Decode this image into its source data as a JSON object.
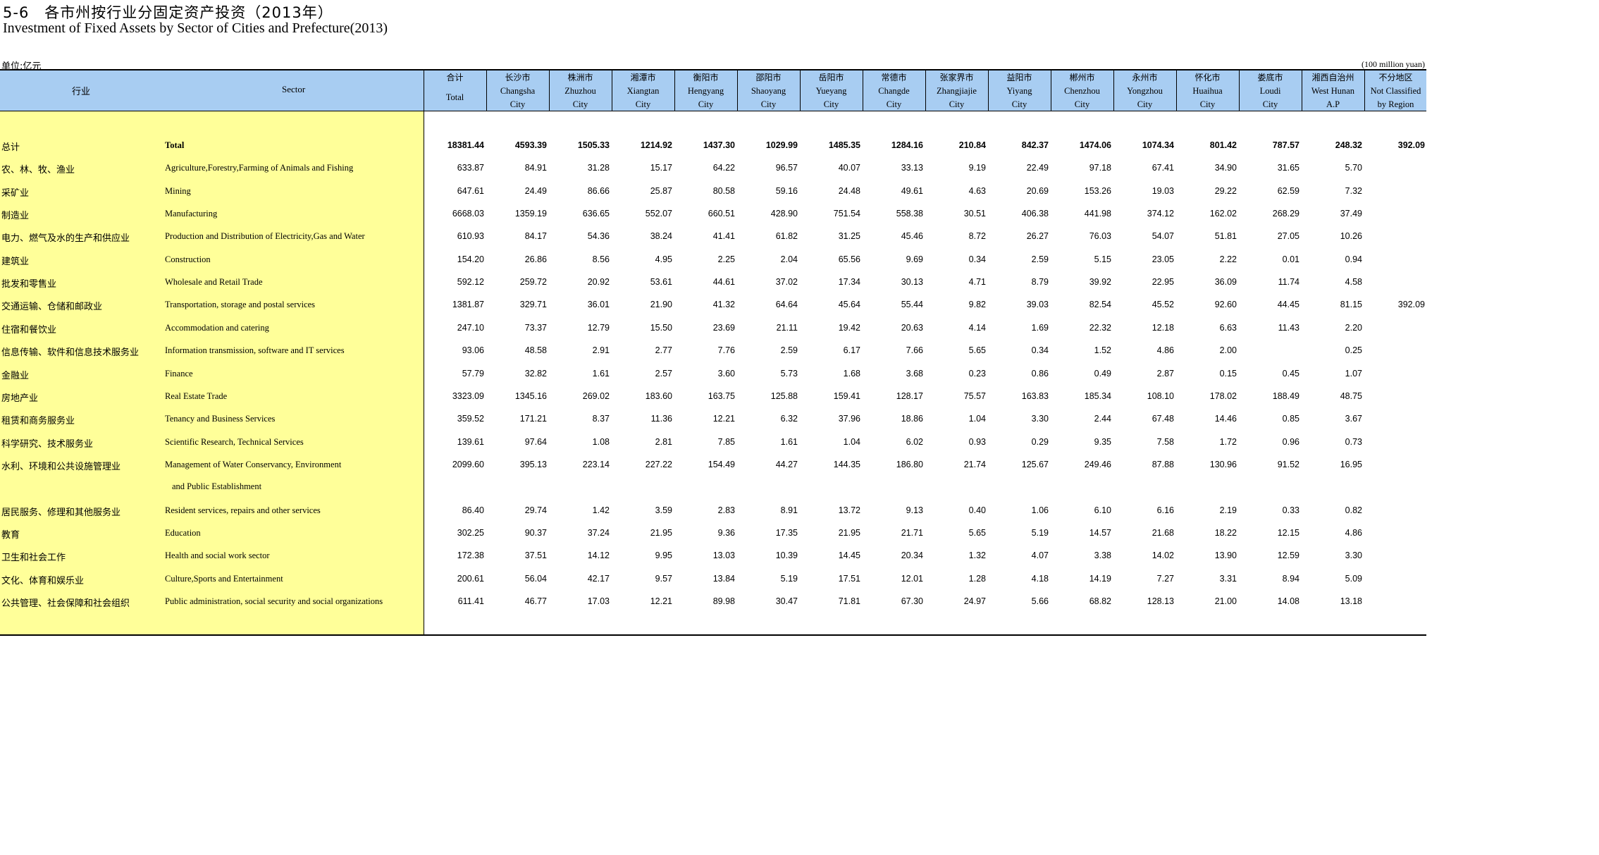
{
  "title_cn": "5-6　各市州按行业分固定资产投资（2013年）",
  "title_en": "Investment  of Fixed Assets by Sector of Cities and Prefecture(2013)",
  "unit_cn": "单位:亿元",
  "unit_en": "(100 million yuan)",
  "header": {
    "sector_cn": "行业",
    "sector_en": "Sector",
    "columns": [
      {
        "l1": "合计",
        "l2": "Total",
        "l3": ""
      },
      {
        "l1": "长沙市",
        "l2": "Changsha",
        "l3": "City"
      },
      {
        "l1": "株洲市",
        "l2": "Zhuzhou",
        "l3": "City"
      },
      {
        "l1": "湘潭市",
        "l2": "Xiangtan",
        "l3": "City"
      },
      {
        "l1": "衡阳市",
        "l2": "Hengyang",
        "l3": "City"
      },
      {
        "l1": "邵阳市",
        "l2": "Shaoyang",
        "l3": "City"
      },
      {
        "l1": "岳阳市",
        "l2": "Yueyang",
        "l3": "City"
      },
      {
        "l1": "常德市",
        "l2": "Changde",
        "l3": "City"
      },
      {
        "l1": "张家界市",
        "l2": "Zhangjiajie",
        "l3": "City"
      },
      {
        "l1": "益阳市",
        "l2": "Yiyang",
        "l3": "City"
      },
      {
        "l1": "郴州市",
        "l2": "Chenzhou",
        "l3": "City"
      },
      {
        "l1": "永州市",
        "l2": "Yongzhou",
        "l3": "City"
      },
      {
        "l1": "怀化市",
        "l2": "Huaihua",
        "l3": "City"
      },
      {
        "l1": "娄底市",
        "l2": "Loudi",
        "l3": "City"
      },
      {
        "l1": "湘西自治州",
        "l2": "West Hunan",
        "l3": "A.P"
      },
      {
        "l1": "不分地区",
        "l2": "Not Classified",
        "l3": "by Region"
      }
    ]
  },
  "rows": [
    {
      "cn": "总计",
      "en": "Total",
      "bold": true,
      "values": [
        "18381.44",
        "4593.39",
        "1505.33",
        "1214.92",
        "1437.30",
        "1029.99",
        "1485.35",
        "1284.16",
        "210.84",
        "842.37",
        "1474.06",
        "1074.34",
        "801.42",
        "787.57",
        "248.32",
        "392.09"
      ]
    },
    {
      "cn": "农、林、牧、渔业",
      "en": "Agriculture,Forestry,Farming of Animals and Fishing",
      "values": [
        "633.87",
        "84.91",
        "31.28",
        "15.17",
        "64.22",
        "96.57",
        "40.07",
        "33.13",
        "9.19",
        "22.49",
        "97.18",
        "67.41",
        "34.90",
        "31.65",
        "5.70",
        ""
      ]
    },
    {
      "cn": "采矿业",
      "en": "Mining",
      "values": [
        "647.61",
        "24.49",
        "86.66",
        "25.87",
        "80.58",
        "59.16",
        "24.48",
        "49.61",
        "4.63",
        "20.69",
        "153.26",
        "19.03",
        "29.22",
        "62.59",
        "7.32",
        ""
      ]
    },
    {
      "cn": "制造业",
      "en": "Manufacturing",
      "values": [
        "6668.03",
        "1359.19",
        "636.65",
        "552.07",
        "660.51",
        "428.90",
        "751.54",
        "558.38",
        "30.51",
        "406.38",
        "441.98",
        "374.12",
        "162.02",
        "268.29",
        "37.49",
        ""
      ]
    },
    {
      "cn": "电力、燃气及水的生产和供应业",
      "en": "Production and Distribution of Electricity,Gas and Water",
      "values": [
        "610.93",
        "84.17",
        "54.36",
        "38.24",
        "41.41",
        "61.82",
        "31.25",
        "45.46",
        "8.72",
        "26.27",
        "76.03",
        "54.07",
        "51.81",
        "27.05",
        "10.26",
        ""
      ]
    },
    {
      "cn": "建筑业",
      "en": "Construction",
      "values": [
        "154.20",
        "26.86",
        "8.56",
        "4.95",
        "2.25",
        "2.04",
        "65.56",
        "9.69",
        "0.34",
        "2.59",
        "5.15",
        "23.05",
        "2.22",
        "0.01",
        "0.94",
        ""
      ]
    },
    {
      "cn": "批发和零售业",
      "en": "Wholesale and Retail Trade",
      "values": [
        "592.12",
        "259.72",
        "20.92",
        "53.61",
        "44.61",
        "37.02",
        "17.34",
        "30.13",
        "4.71",
        "8.79",
        "39.92",
        "22.95",
        "36.09",
        "11.74",
        "4.58",
        ""
      ]
    },
    {
      "cn": "交通运输、仓储和邮政业",
      "en": "Transportation, storage and postal services",
      "values": [
        "1381.87",
        "329.71",
        "36.01",
        "21.90",
        "41.32",
        "64.64",
        "45.64",
        "55.44",
        "9.82",
        "39.03",
        "82.54",
        "45.52",
        "92.60",
        "44.45",
        "81.15",
        "392.09"
      ]
    },
    {
      "cn": "住宿和餐饮业",
      "en": "Accommodation and catering",
      "values": [
        "247.10",
        "73.37",
        "12.79",
        "15.50",
        "23.69",
        "21.11",
        "19.42",
        "20.63",
        "4.14",
        "1.69",
        "22.32",
        "12.18",
        "6.63",
        "11.43",
        "2.20",
        ""
      ]
    },
    {
      "cn": "信息传输、软件和信息技术服务业",
      "en": "Information transmission, software and IT services",
      "values": [
        "93.06",
        "48.58",
        "2.91",
        "2.77",
        "7.76",
        "2.59",
        "6.17",
        "7.66",
        "5.65",
        "0.34",
        "1.52",
        "4.86",
        "2.00",
        "",
        "0.25",
        ""
      ]
    },
    {
      "cn": "金融业",
      "en": "Finance",
      "values": [
        "57.79",
        "32.82",
        "1.61",
        "2.57",
        "3.60",
        "5.73",
        "1.68",
        "3.68",
        "0.23",
        "0.86",
        "0.49",
        "2.87",
        "0.15",
        "0.45",
        "1.07",
        ""
      ]
    },
    {
      "cn": "房地产业",
      "en": "Real Estate Trade",
      "values": [
        "3323.09",
        "1345.16",
        "269.02",
        "183.60",
        "163.75",
        "125.88",
        "159.41",
        "128.17",
        "75.57",
        "163.83",
        "185.34",
        "108.10",
        "178.02",
        "188.49",
        "48.75",
        ""
      ]
    },
    {
      "cn": "租赁和商务服务业",
      "en": "Tenancy and Business Services",
      "values": [
        "359.52",
        "171.21",
        "8.37",
        "11.36",
        "12.21",
        "6.32",
        "37.96",
        "18.86",
        "1.04",
        "3.30",
        "2.44",
        "67.48",
        "14.46",
        "0.85",
        "3.67",
        ""
      ]
    },
    {
      "cn": "科学研究、技术服务业",
      "en": "Scientific Research, Technical Services",
      "values": [
        "139.61",
        "97.64",
        "1.08",
        "2.81",
        "7.85",
        "1.61",
        "1.04",
        "6.02",
        "0.93",
        "0.29",
        "9.35",
        "7.58",
        "1.72",
        "0.96",
        "0.73",
        ""
      ]
    },
    {
      "cn": "水利、环境和公共设施管理业",
      "en": "Management of Water Conservancy, Environment",
      "values": [
        "2099.60",
        "395.13",
        "223.14",
        "227.22",
        "154.49",
        "44.27",
        "144.35",
        "186.80",
        "21.74",
        "125.67",
        "249.46",
        "87.88",
        "130.96",
        "91.52",
        "16.95",
        ""
      ]
    },
    {
      "cn": "居民服务、修理和其他服务业",
      "en": "Resident services, repairs and other services",
      "values": [
        "86.40",
        "29.74",
        "1.42",
        "3.59",
        "2.83",
        "8.91",
        "13.72",
        "9.13",
        "0.40",
        "1.06",
        "6.10",
        "6.16",
        "2.19",
        "0.33",
        "0.82",
        ""
      ]
    },
    {
      "cn": "教育",
      "en": "Education",
      "values": [
        "302.25",
        "90.37",
        "37.24",
        "21.95",
        "9.36",
        "17.35",
        "21.95",
        "21.71",
        "5.65",
        "5.19",
        "14.57",
        "21.68",
        "18.22",
        "12.15",
        "4.86",
        ""
      ]
    },
    {
      "cn": "卫生和社会工作",
      "en": "Health and social work sector",
      "values": [
        "172.38",
        "37.51",
        "14.12",
        "9.95",
        "13.03",
        "10.39",
        "14.45",
        "20.34",
        "1.32",
        "4.07",
        "3.38",
        "14.02",
        "13.90",
        "12.59",
        "3.30",
        ""
      ]
    },
    {
      "cn": "文化、体育和娱乐业",
      "en": "Culture,Sports and Entertainment",
      "values": [
        "200.61",
        "56.04",
        "42.17",
        "9.57",
        "13.84",
        "5.19",
        "17.51",
        "12.01",
        "1.28",
        "4.18",
        "14.19",
        "7.27",
        "3.31",
        "8.94",
        "5.09",
        ""
      ]
    },
    {
      "cn": "公共管理、社会保障和社会组织",
      "en": "Public administration, social security and social organizations",
      "values": [
        "611.41",
        "46.77",
        "17.03",
        "12.21",
        "89.98",
        "30.47",
        "71.81",
        "67.30",
        "24.97",
        "5.66",
        "68.82",
        "128.13",
        "21.00",
        "14.08",
        "13.18",
        ""
      ]
    }
  ],
  "continuation_en": "and Public Establishment"
}
